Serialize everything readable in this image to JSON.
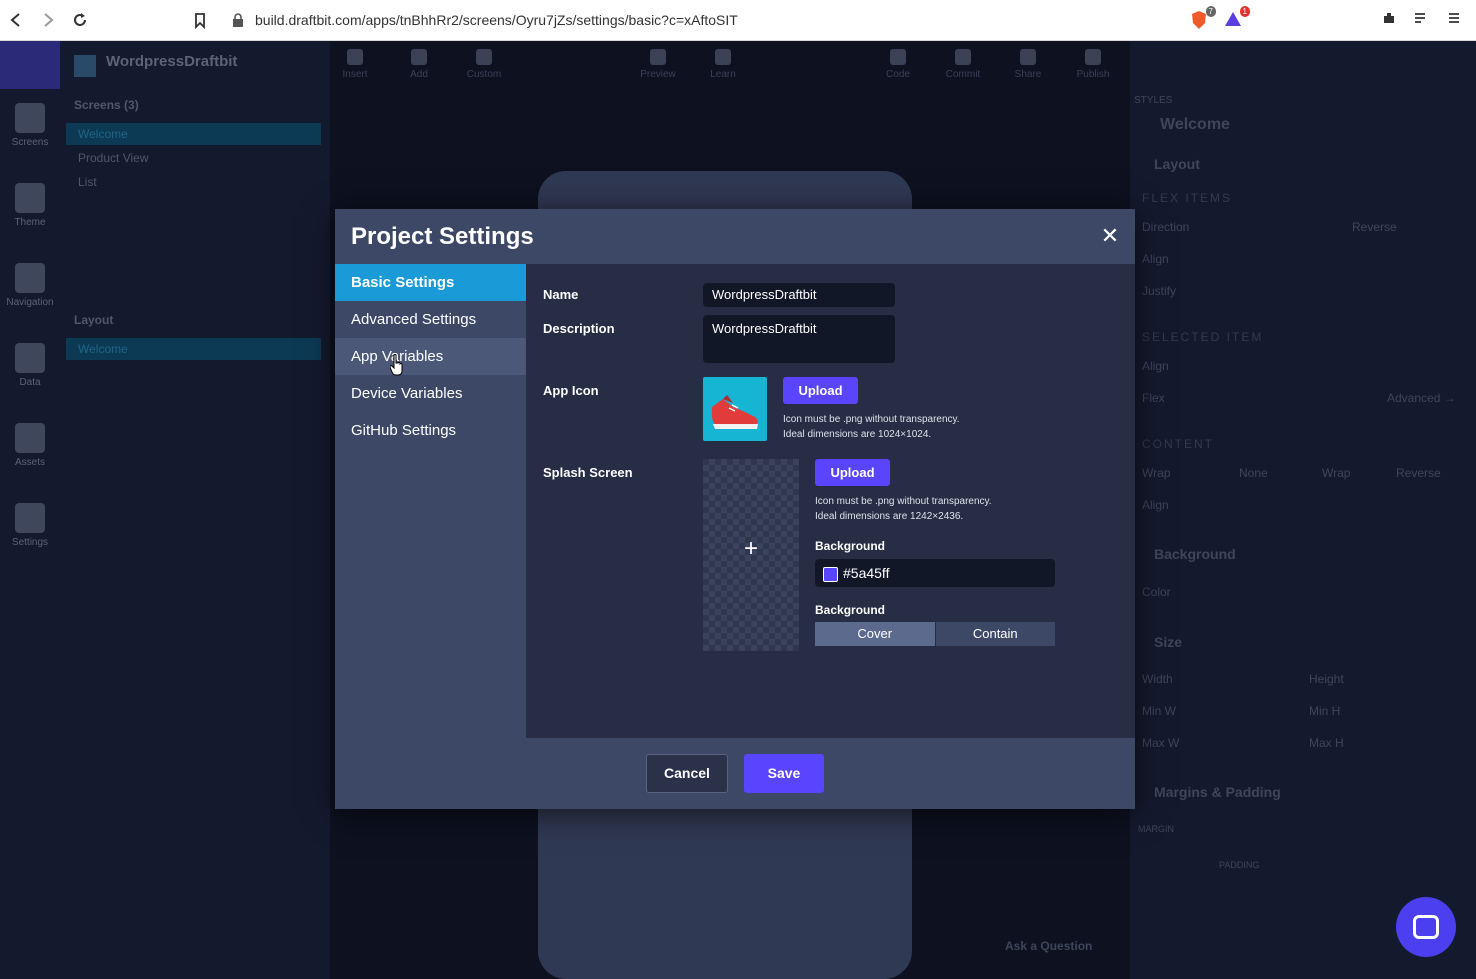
{
  "browser": {
    "url": "build.draftbit.com/apps/tnBhhRr2/screens/Oyru7jZs/settings/basic?c=xAftoSIT",
    "brave_badge": "7",
    "alert_badge": "1"
  },
  "app": {
    "project_name": "WordpressDraftbit",
    "nav_items": [
      "Screens",
      "Theme",
      "Navigation",
      "Data",
      "Assets",
      "Settings"
    ],
    "screens_title": "Screens (3)",
    "screens": [
      "Welcome",
      "Product View",
      "List"
    ],
    "layout_title": "Layout",
    "layout_items": [
      "Welcome"
    ],
    "toolbar": [
      "Insert",
      "Add",
      "Custom",
      "Preview",
      "Learn",
      "Code",
      "Commit",
      "Share",
      "Publish"
    ],
    "styles_label": "STYLES",
    "styles_screen": "Welcome",
    "right_panel": {
      "layout": "Layout",
      "flex_items": "FLEX ITEMS",
      "direction": "Direction",
      "reverse": "Reverse",
      "align": "Align",
      "justify": "Justify",
      "selected_item": "SELECTED ITEM",
      "flex": "Flex",
      "advanced": "Advanced →",
      "content": "CONTENT",
      "wrap": "Wrap",
      "none": "None",
      "wrap_opt": "Wrap",
      "reverse_opt": "Reverse",
      "background": "Background",
      "color": "Color",
      "size": "Size",
      "width": "Width",
      "height": "Height",
      "min_w": "Min W",
      "min_h": "Min H",
      "max_w": "Max W",
      "max_h": "Max H",
      "margins_padding": "Margins & Padding",
      "margin": "MARGIN",
      "padding": "PADDING"
    },
    "ask_question": "Ask a Question"
  },
  "modal": {
    "title": "Project Settings",
    "close": "✕",
    "tabs": [
      "Basic Settings",
      "Advanced Settings",
      "App Variables",
      "Device Variables",
      "GitHub Settings"
    ],
    "active_tab": 0,
    "fields": {
      "name_label": "Name",
      "name_value": "WordpressDraftbit",
      "description_label": "Description",
      "description_value": "WordpressDraftbit",
      "app_icon_label": "App Icon",
      "app_icon_upload": "Upload",
      "app_icon_hint_1": "Icon must be .png without transparency.",
      "app_icon_hint_2": "Ideal dimensions are 1024×1024.",
      "splash_label": "Splash Screen",
      "splash_upload": "Upload",
      "splash_hint_1": "Icon must be .png without transparency.",
      "splash_hint_2": "Ideal dimensions are 1242×2436.",
      "background_label": "Background",
      "background_color": "#5a45ff",
      "resize_label": "Background",
      "resize_options": [
        "Cover",
        "Contain"
      ],
      "resize_selected": "Cover"
    },
    "cancel": "Cancel",
    "save": "Save"
  },
  "colors": {
    "accent": "#5a45ff",
    "active_tab": "#1a9bd7"
  }
}
